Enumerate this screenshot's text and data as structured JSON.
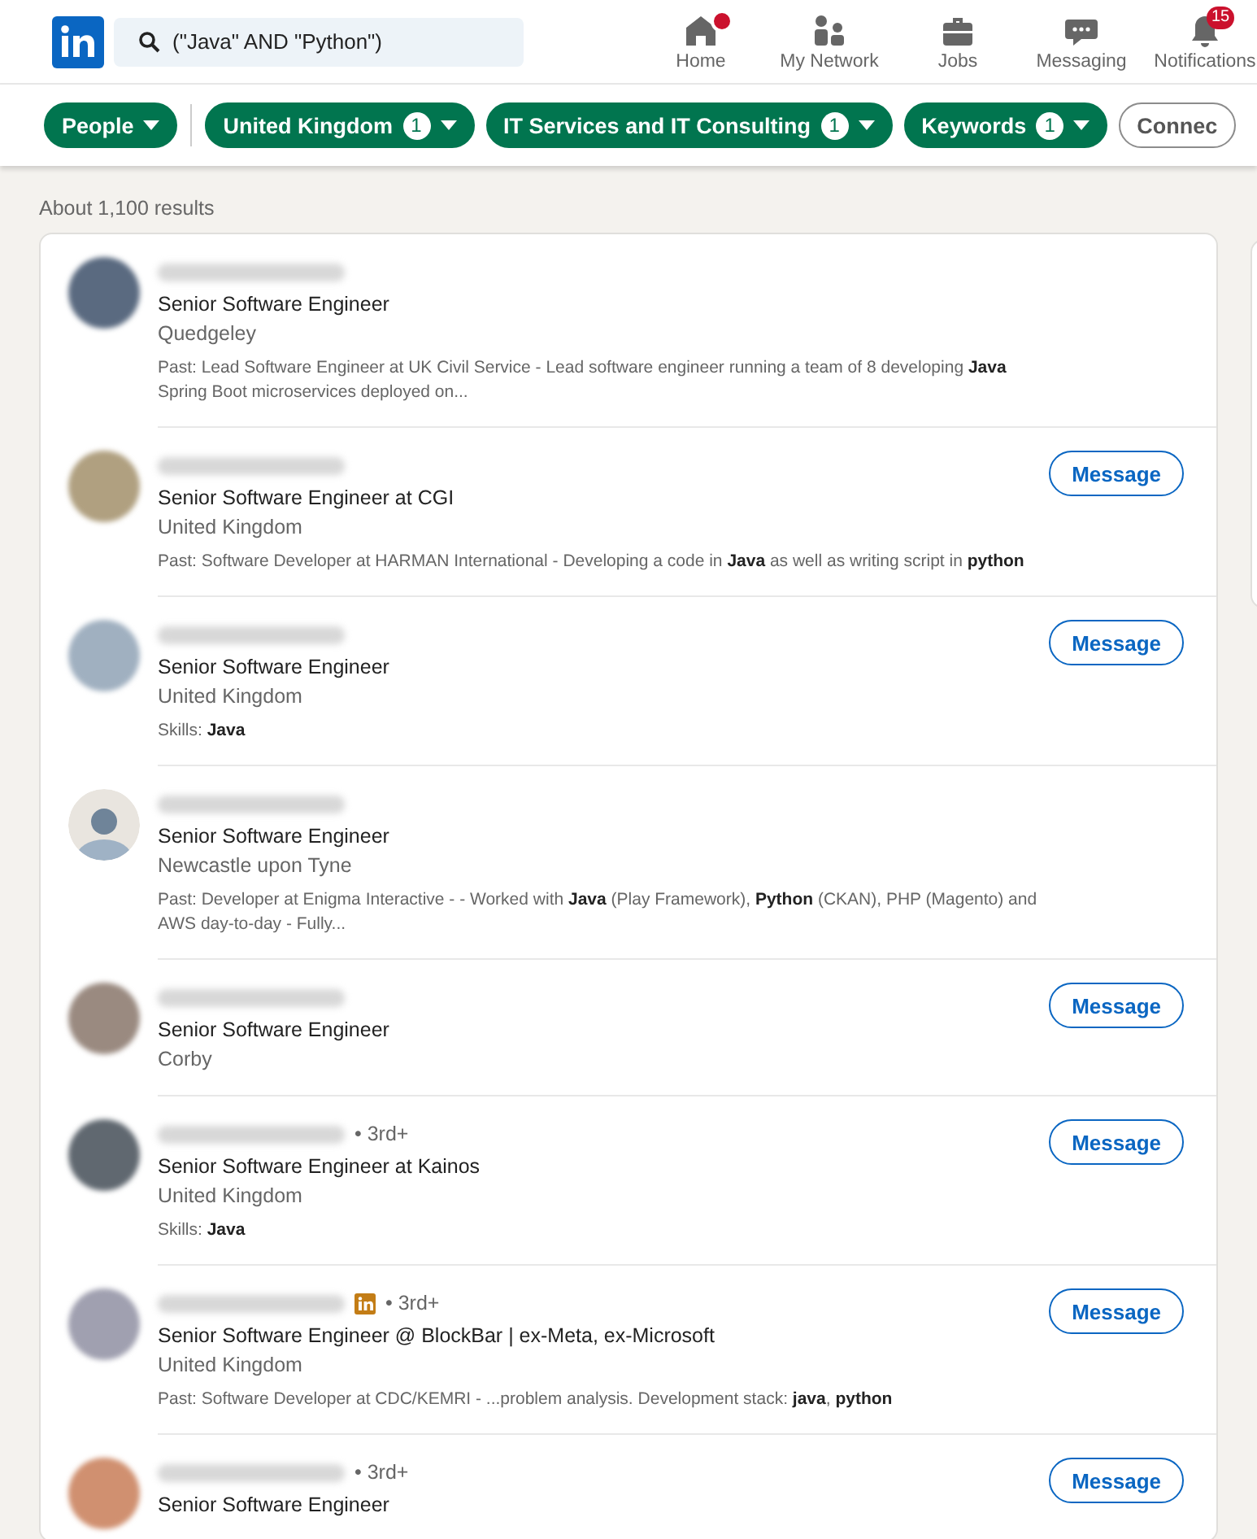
{
  "search": {
    "value": "(\"Java\" AND \"Python\")"
  },
  "nav": [
    {
      "kind": "home",
      "label": "Home",
      "dot": true
    },
    {
      "kind": "network",
      "label": "My Network"
    },
    {
      "kind": "jobs",
      "label": "Jobs"
    },
    {
      "kind": "messaging",
      "label": "Messaging"
    },
    {
      "kind": "notifications",
      "label": "Notifications",
      "badge": "15"
    }
  ],
  "filters": [
    {
      "label": "People",
      "selected": true,
      "dropdown": true
    },
    {
      "label": "United Kingdom",
      "count": "1",
      "selected": true,
      "dropdown": true
    },
    {
      "label": "IT Services and IT Consulting",
      "count": "1",
      "selected": true,
      "dropdown": true
    },
    {
      "label": "Keywords",
      "count": "1",
      "selected": true,
      "dropdown": true
    },
    {
      "label": "Connec",
      "selected": false
    }
  ],
  "results_count": "About 1,100 results",
  "results": [
    {
      "kind": "photo",
      "title": "Senior Software Engineer",
      "location": "Quedgeley",
      "summary": "Past: Lead Software Engineer at UK Civil Service - Lead software engineer running a team of 8 developing **Java** Spring Boot microservices deployed on..."
    },
    {
      "kind": "photo",
      "title": "Senior Software Engineer at CGI",
      "location": "United Kingdom",
      "summary": "Past: Software Developer at HARMAN International - Developing a code in **Java** as well as writing script in **python**",
      "message": "Message"
    },
    {
      "kind": "photo",
      "title": "Senior Software Engineer",
      "location": "United Kingdom",
      "summary": "Skills: **Java**",
      "message": "Message"
    },
    {
      "kind": "default",
      "title": "Senior Software Engineer",
      "location": "Newcastle upon Tyne",
      "summary": "Past: Developer at Enigma Interactive - - Worked with **Java** (Play Framework), **Python** (CKAN), PHP (Magento) and AWS day-to-day - Fully..."
    },
    {
      "kind": "photo",
      "title": "Senior Software Engineer",
      "location": "Corby",
      "message": "Message"
    },
    {
      "kind": "photo",
      "degree": "• 3rd+",
      "title": "Senior Software Engineer at Kainos",
      "location": "United Kingdom",
      "summary": "Skills: **Java**",
      "message": "Message"
    },
    {
      "kind": "photo",
      "premium": true,
      "degree": "• 3rd+",
      "title": "Senior Software Engineer @ BlockBar | ex-Meta, ex-Microsoft",
      "location": "United Kingdom",
      "summary": "Past: Software Developer at CDC/KEMRI - ...problem analysis. Development stack: **java**, **python**",
      "message": "Message"
    },
    {
      "kind": "photo",
      "degree": "• 3rd+",
      "title": "Senior Software Engineer",
      "message": "Message"
    }
  ]
}
